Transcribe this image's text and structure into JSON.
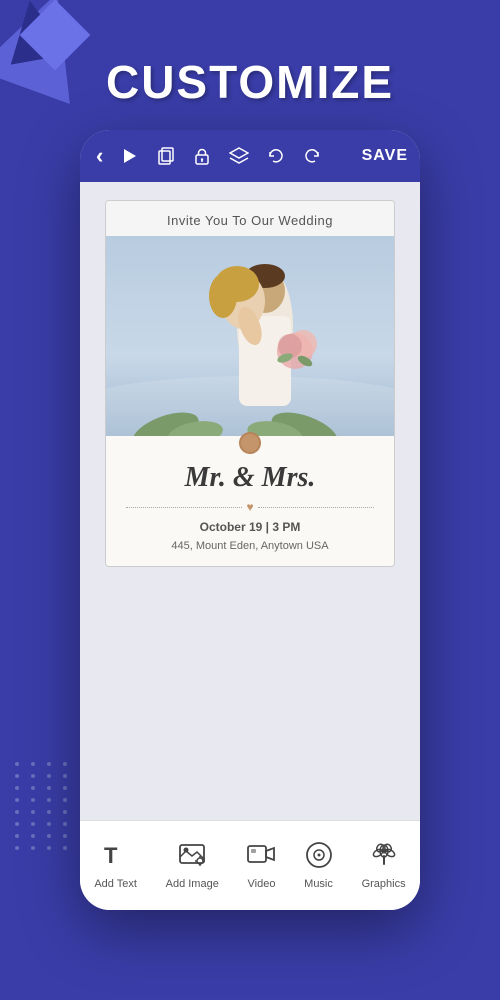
{
  "page": {
    "background_color": "#3a3da8"
  },
  "title": {
    "text": "CUSTOMIZE"
  },
  "toolbar": {
    "back_label": "‹",
    "play_label": "▶",
    "copy_label": "⧉",
    "lock_label": "🔓",
    "layers_label": "⧫",
    "undo_label": "↺",
    "redo_label": "↻",
    "save_label": "SAVE"
  },
  "card": {
    "header_text": "Invite You To Our Wedding",
    "couple_name": "Mr. & Mrs.",
    "date": "October 19 | 3 PM",
    "address": "445, Mount Eden, Anytown USA"
  },
  "bottom_nav": {
    "items": [
      {
        "id": "add-text",
        "icon": "T",
        "label": "Add Text"
      },
      {
        "id": "add-image",
        "icon": "🖼",
        "label": "Add Image"
      },
      {
        "id": "video",
        "icon": "📽",
        "label": "Video"
      },
      {
        "id": "music",
        "icon": "🎵",
        "label": "Music"
      },
      {
        "id": "graphics",
        "icon": "🌿",
        "label": "Graphics"
      }
    ]
  }
}
